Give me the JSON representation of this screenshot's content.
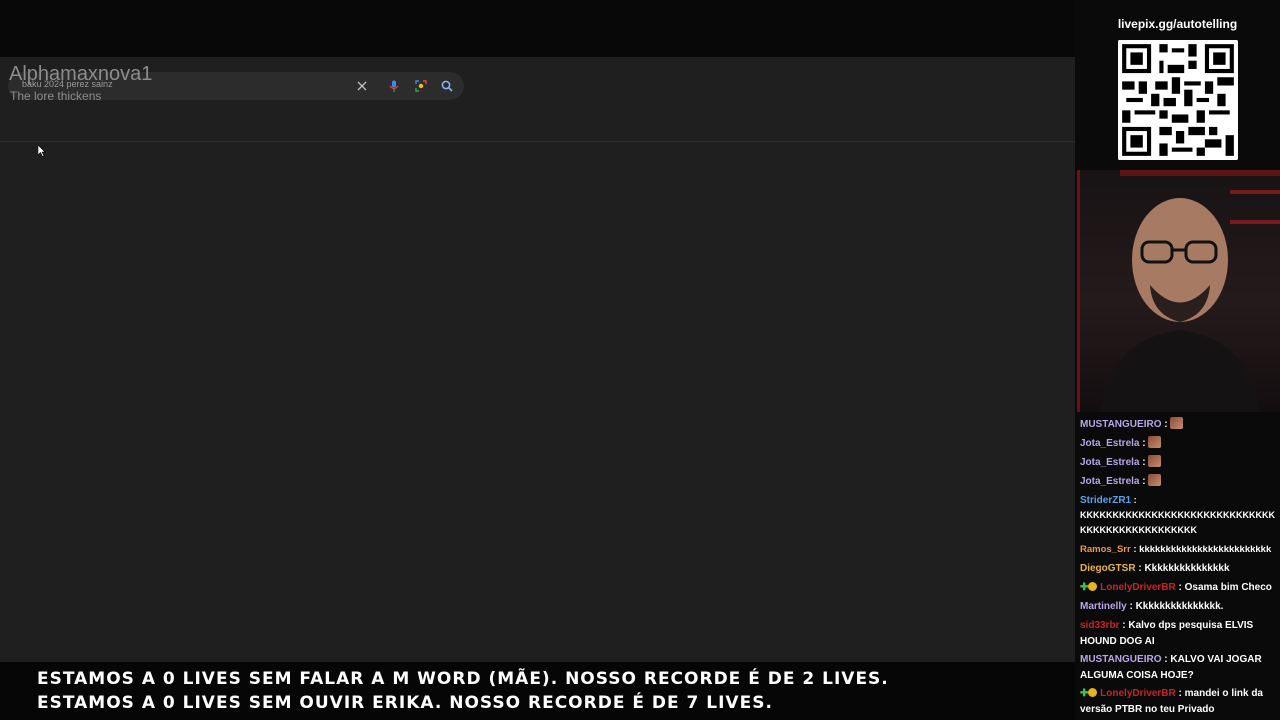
{
  "search": {
    "query": "baku 2024 perez sainz"
  },
  "overlay": {
    "alert_name": "Alphamaxnova1",
    "alert_message": "The lore thickens"
  },
  "sidebar": {
    "livepix_url": "livepix.gg/autotelling"
  },
  "chat": {
    "messages": [
      {
        "user": "MUSTANGUEIRO",
        "user_color": "#b7a6e8",
        "text": "",
        "emote": true
      },
      {
        "user": "Jota_Estrela",
        "user_color": "#b7a6e8",
        "text": "",
        "emote": true
      },
      {
        "user": "Jota_Estrela",
        "user_color": "#b7a6e8",
        "text": "",
        "emote": true
      },
      {
        "user": "Jota_Estrela",
        "user_color": "#b7a6e8",
        "text": "",
        "emote": true
      },
      {
        "user": "StriderZR1",
        "user_color": "#5aa3e8",
        "text": "KKKKKKKKKKKKKKKKKKKKKKKKKKKKKKKKKKKKKKKKKKKKKKKK"
      },
      {
        "user": "Ramos_Srr",
        "user_color": "#e89a4a",
        "text": "kkkkkkkkkkkkkkkkkkkkkkkkk"
      },
      {
        "user": "DiegoGTSR",
        "user_color": "#e8b34a",
        "text": "Kkkkkkkkkkkkkkk"
      },
      {
        "user": "LonelyDriverBR",
        "user_color": "#c8222a",
        "text": "Osama bim Checo",
        "badges": true
      },
      {
        "user": "Martinelly",
        "user_color": "#b7a6e8",
        "text": "Kkkkkkkkkkkkkkk."
      },
      {
        "user": "sid33rbr",
        "user_color": "#c8222a",
        "text": "Kalvo dps pesquisa ELVIS HOUND DOG AI"
      },
      {
        "user": "MUSTANGUEIRO",
        "user_color": "#b7a6e8",
        "text": "KALVO VAI JOGAR ALGUMA COISA HOJE?"
      },
      {
        "user": "LonelyDriverBR",
        "user_color": "#c8222a",
        "text": "mandei o link da versão PTBR no teu Privado",
        "badges": true
      }
    ]
  },
  "ticker": {
    "line1": "ESTAMOS A 0 LIVES SEM FALAR A M WORD (MÃE). NOSSO RECORDE É DE 2 LIVES.",
    "line2": "ESTAMOS A 0 LIVES SEM OUVIR ERIKA. NOSSO RECORDE É DE 7 LIVES."
  },
  "colors": {
    "accent_red": "#c8222a",
    "chat_username": "#b7a6e8"
  },
  "icons": [
    "clear-icon",
    "microphone-icon",
    "lens-icon",
    "search-icon",
    "qr-code",
    "mouse-cursor-icon",
    "emote-icon",
    "sub-badge-icon",
    "bits-badge-icon"
  ]
}
